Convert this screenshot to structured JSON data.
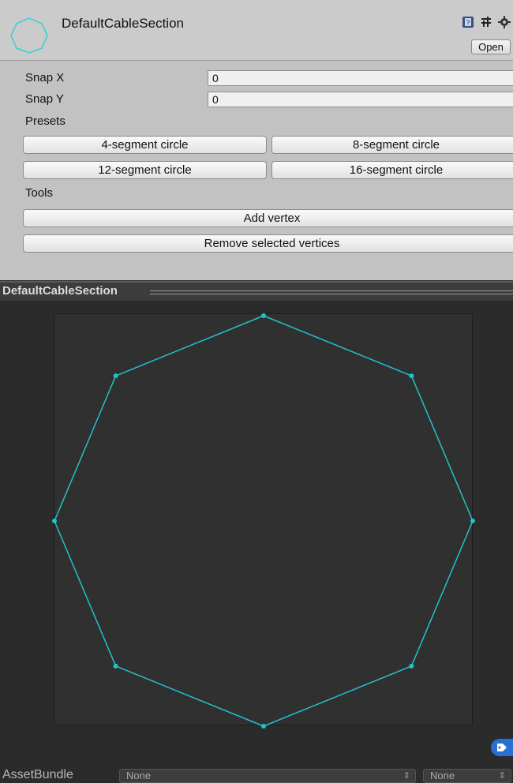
{
  "header": {
    "asset_name": "DefaultCableSection",
    "open_label": "Open",
    "icons": [
      "help-book-icon",
      "settings-sliders-icon",
      "gear-icon"
    ],
    "accent_color": "#35d0d8"
  },
  "fields": {
    "snap_x_label": "Snap X",
    "snap_x_value": "0",
    "snap_y_label": "Snap Y",
    "snap_y_value": "0"
  },
  "presets": {
    "label": "Presets",
    "buttons": [
      "4-segment circle",
      "8-segment circle",
      "12-segment circle",
      "16-segment circle"
    ]
  },
  "tools": {
    "label": "Tools",
    "add_vertex": "Add vertex",
    "remove_vertices": "Remove selected vertices"
  },
  "preview": {
    "title": "DefaultCableSection",
    "line_color": "#1fc3cc",
    "vertices": [
      [
        0,
        1
      ],
      [
        0.7071,
        0.7071
      ],
      [
        1,
        0
      ],
      [
        0.7071,
        -0.7071
      ],
      [
        0,
        -1
      ],
      [
        -0.7071,
        -0.7071
      ],
      [
        -1,
        0
      ],
      [
        -0.7071,
        0.7071
      ]
    ]
  },
  "assetbundle": {
    "label": "AssetBundle",
    "name_value": "None",
    "variant_value": "None"
  }
}
